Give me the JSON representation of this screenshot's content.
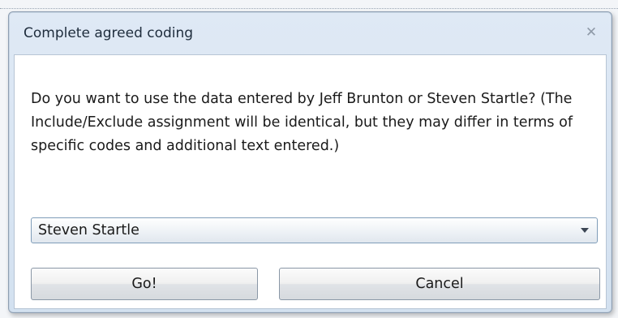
{
  "dialog": {
    "title": "Complete agreed coding",
    "close_icon": "close-icon",
    "message": "Do you want to use the data entered by Jeff Brunton or Steven Startle? (The Include/Exclude assignment will be identical, but they may differ in terms of specific codes and additional text entered.)",
    "coder_select": {
      "selected": "Steven Startle"
    },
    "buttons": {
      "go": "Go!",
      "cancel": "Cancel"
    }
  },
  "colors": {
    "title_bar": "#d3e1f0",
    "content_bg": "#ffffff",
    "border": "#8d9eb2"
  }
}
